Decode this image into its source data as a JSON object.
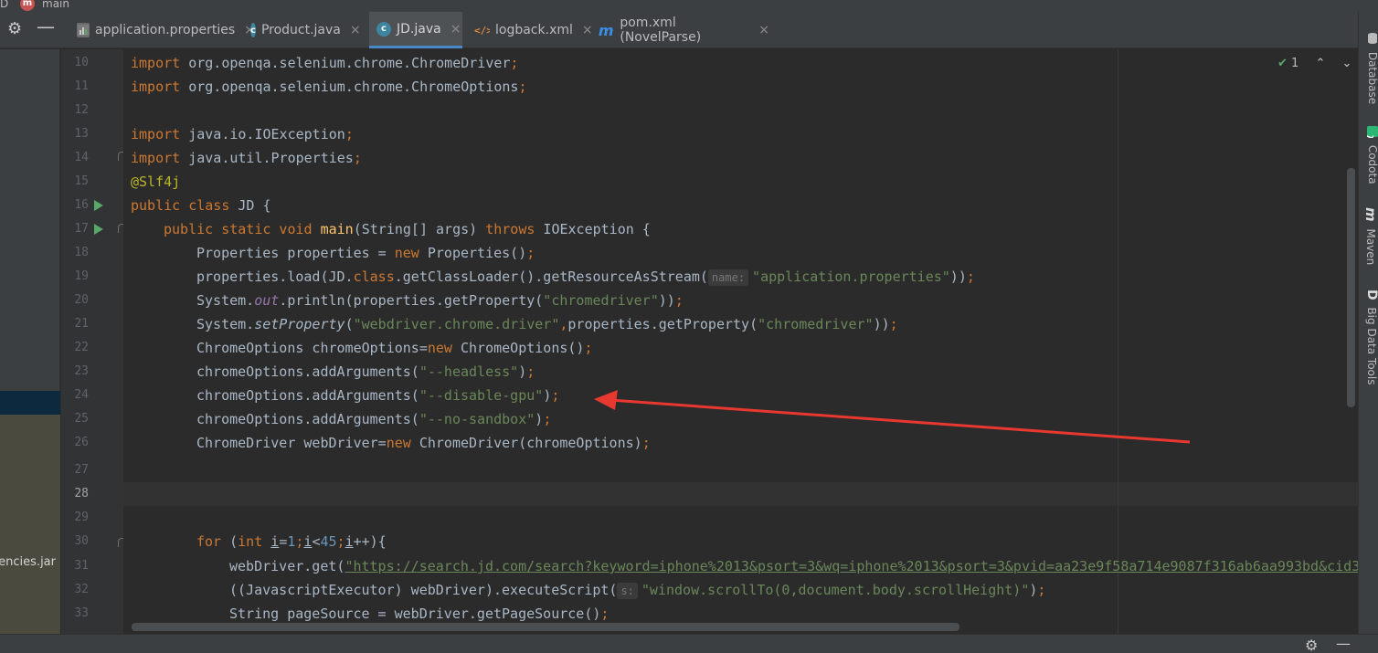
{
  "breadcrumb": {
    "left_fragment": "D",
    "module_badge": "m",
    "module": "main"
  },
  "toolbar": {
    "settings_icon": "gear-icon",
    "collapse_icon": "minus-icon"
  },
  "tabs": [
    {
      "label": "application.properties",
      "icon": "properties-file-icon",
      "active": false,
      "close": "×"
    },
    {
      "label": "Product.java",
      "icon": "class-icon",
      "icon_glyph": "c",
      "active": false,
      "close": "×"
    },
    {
      "label": "JD.java",
      "icon": "class-icon",
      "icon_glyph": "c",
      "active": true,
      "close": "×"
    },
    {
      "label": "logback.xml",
      "icon": "xml-file-icon",
      "active": false,
      "close": "×"
    },
    {
      "label": "pom.xml (NovelParse)",
      "icon": "maven-icon",
      "icon_glyph": "m",
      "active": false,
      "close": "×"
    }
  ],
  "left_panel": {
    "visible_text": "encies.jar"
  },
  "gutter": {
    "line_numbers": [
      "10",
      "11",
      "12",
      "13",
      "14",
      "15",
      "16",
      "17",
      "18",
      "19",
      "20",
      "21",
      "22",
      "23",
      "24",
      "25",
      "26",
      "27",
      "28",
      "29",
      "30",
      "31",
      "32",
      "33"
    ]
  },
  "code": {
    "l10": [
      "import",
      " org.openqa.selenium.chrome.ChromeDriver",
      ";"
    ],
    "l11": [
      "import",
      " org.openqa.selenium.chrome.ChromeOptions",
      ";"
    ],
    "l13": [
      "import",
      " java.io.IOException",
      ";"
    ],
    "l14": [
      "import",
      " java.util.Properties",
      ";"
    ],
    "l15": "@Slf4j",
    "l16": [
      "public class",
      " JD {"
    ],
    "l17": [
      "public static void",
      " ",
      "main",
      "(String[] args) ",
      "throws",
      " IOException {"
    ],
    "l18": [
      "Properties properties = ",
      "new",
      " Properties()",
      ";"
    ],
    "l19": [
      "properties.load(JD.",
      "class",
      ".getClassLoader().getResourceAsStream(",
      "name:",
      "\"application.properties\"",
      "))",
      ";"
    ],
    "l20": [
      "System.",
      "out",
      ".println(properties.getProperty(",
      "\"chromedriver\"",
      "))",
      ";"
    ],
    "l21": [
      "System.",
      "setProperty",
      "(",
      "\"webdriver.chrome.driver\"",
      ",",
      "properties.getProperty(",
      "\"chromedriver\"",
      "))",
      ";"
    ],
    "l22": [
      "ChromeOptions chromeOptions=",
      "new",
      " ChromeOptions()",
      ";"
    ],
    "l23": [
      "chromeOptions.addArguments(",
      "\"--headless\"",
      ")",
      ";"
    ],
    "l24": [
      "chromeOptions.addArguments(",
      "\"--disable-gpu\"",
      ")",
      ";"
    ],
    "l25": [
      "chromeOptions.addArguments(",
      "\"--no-sandbox\"",
      ")",
      ";"
    ],
    "l26": [
      "ChromeDriver webDriver=",
      "new",
      " ChromeDriver(chromeOptions)",
      ";"
    ],
    "l30": [
      "for",
      " (",
      "int",
      " ",
      "i",
      "=",
      "1",
      ";",
      "i",
      "<",
      "45",
      ";",
      "i",
      "++){"
    ],
    "l31": [
      "webDriver.get(",
      "\"https://search.jd.com/search?keyword=iphone%2013&psort=3&wq=iphone%2013&psort=3&pvid=aa23e9f58a714e9087f316ab6aa993bd&cid3"
    ],
    "l32": [
      "((JavascriptExecutor) webDriver).executeScript(",
      "s:",
      "\"window.scrollTo(0,document.body.scrollHeight)\"",
      ")",
      ";"
    ],
    "l33": [
      "String pageSource = webDriver.getPageSource()",
      ";"
    ]
  },
  "inspection": {
    "status_icon": "double-check-icon",
    "count": "1",
    "prev": "⌃",
    "next": "⌄"
  },
  "right_tools": [
    {
      "label": "Database",
      "icon": "database-icon"
    },
    {
      "label": "Codota",
      "icon": "codota-icon"
    },
    {
      "label": "Maven",
      "icon": "maven-icon",
      "glyph": "m"
    },
    {
      "label": "Big Data Tools",
      "icon": "big-data-tools-icon",
      "glyph": "D"
    }
  ],
  "colors": {
    "keyword": "#cc7832",
    "string": "#6a8759",
    "annotation": "#bbb529",
    "method": "#ffc66d",
    "field": "#9876aa",
    "number": "#6897bb",
    "active_tab_underline": "#4a88c7",
    "arrow": "#e8382f"
  }
}
